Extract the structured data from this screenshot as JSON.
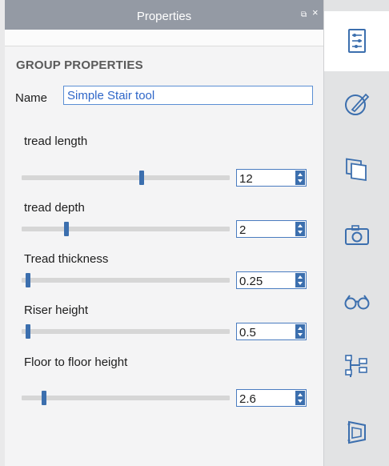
{
  "panel": {
    "title": "Properties",
    "pin_glyph": "⧉",
    "close_glyph": "×",
    "section_title": "GROUP PROPERTIES",
    "name_label": "Name",
    "name_value": "Simple Stair tool"
  },
  "params": [
    {
      "label": "tread length",
      "value": "12",
      "slider_fraction": 0.58
    },
    {
      "label": "tread depth",
      "value": "2",
      "slider_fraction": 0.21
    },
    {
      "label": "Tread thickness",
      "value": "0.25",
      "slider_fraction": 0.02
    },
    {
      "label": "Riser height",
      "value": "0.5",
      "slider_fraction": 0.02
    },
    {
      "label": "Floor to floor height",
      "value": "2.6",
      "slider_fraction": 0.1
    }
  ],
  "toolbar": {
    "items": [
      {
        "icon": "properties-icon",
        "active": true
      },
      {
        "icon": "materials-icon",
        "active": false
      },
      {
        "icon": "layers-icon",
        "active": false
      },
      {
        "icon": "camera-icon",
        "active": false
      },
      {
        "icon": "display-glasses-icon",
        "active": false
      },
      {
        "icon": "hierarchy-icon",
        "active": false
      },
      {
        "icon": "storyboard-icon",
        "active": false
      }
    ]
  },
  "colors": {
    "accent": "#3c6fae",
    "titlebar": "#949aa4",
    "input_text": "#2e66c8"
  }
}
